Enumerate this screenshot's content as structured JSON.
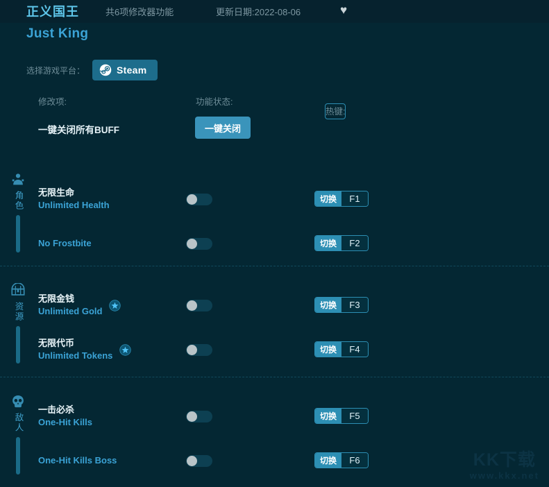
{
  "header": {
    "title_cn": "正义国王",
    "title_en": "Just King",
    "feature_count": "共6项修改器功能",
    "update_date": "更新日期:2022-08-06",
    "favorite_icon": "heart-icon"
  },
  "platform": {
    "label": "选择游戏平台：",
    "selected": "Steam",
    "icon": "steam-icon"
  },
  "columns": {
    "mod": "修改项:",
    "state": "功能状态:",
    "hotkey": "热键:"
  },
  "onekey": {
    "label": "一键关闭所有BUFF",
    "button": "一键关闭"
  },
  "toggle_action_label": "切换",
  "colors": {
    "background": "#042733",
    "header_band": "#06222e",
    "accent_blue": "#3ba3d6",
    "title_cn": "#5ec6ea",
    "steam_button": "#1d6d8c",
    "onekey_button": "#3a94bb",
    "hotkey_action": "#2d8fb4",
    "category_bar": "#1a6b87",
    "toggle_track": "#0d4052",
    "toggle_knob": "#b9c4c8",
    "muted_text": "#6e8d98",
    "separator": "#11495c",
    "watermark": "#0c3344"
  },
  "sections": [
    {
      "id": "character",
      "icon": "character-icon",
      "label": "角色",
      "rows": [
        {
          "name_cn": "无限生命",
          "name_en": "Unlimited Health",
          "starred": false,
          "enabled": false,
          "hotkey": "F1"
        },
        {
          "name_cn": "",
          "name_en": "No Frostbite",
          "starred": false,
          "enabled": false,
          "hotkey": "F2"
        }
      ]
    },
    {
      "id": "resources",
      "icon": "chest-icon",
      "label": "资源",
      "rows": [
        {
          "name_cn": "无限金钱",
          "name_en": "Unlimited Gold",
          "starred": true,
          "enabled": false,
          "hotkey": "F3"
        },
        {
          "name_cn": "无限代币",
          "name_en": "Unlimited Tokens",
          "starred": true,
          "enabled": false,
          "hotkey": "F4"
        }
      ]
    },
    {
      "id": "enemies",
      "icon": "skull-icon",
      "label": "敌人",
      "rows": [
        {
          "name_cn": "一击必杀",
          "name_en": "One-Hit Kills",
          "starred": false,
          "enabled": false,
          "hotkey": "F5"
        },
        {
          "name_cn": "",
          "name_en": "One-Hit Kills Boss",
          "starred": false,
          "enabled": false,
          "hotkey": "F6"
        }
      ]
    }
  ],
  "watermark": {
    "main": "KK下载",
    "sub": "www.kkx.net"
  }
}
